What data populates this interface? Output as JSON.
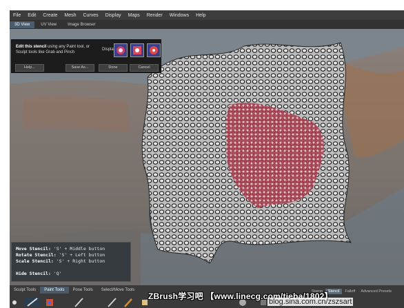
{
  "menu": [
    "File",
    "Edit",
    "Create",
    "Mesh",
    "Curves",
    "Display",
    "Maps",
    "Render",
    "Windows",
    "Help"
  ],
  "view_tabs": [
    "3D View",
    "UV View",
    "Image Browser"
  ],
  "stencil_panel": {
    "bold": "Edit this stencil",
    "text": " using any Paint tool, or Sculpt tools like Grab and Pinch",
    "display_label": "Display:",
    "buttons": [
      "Help...",
      "Save As...",
      "Done",
      "Cancel"
    ]
  },
  "hints": {
    "move_label": "Move Stencil:",
    "move_keys": "'S' + Middle button",
    "rotate_label": "Rotate Stencil:",
    "rotate_keys": "'S' + Left button",
    "scale_label": "Scale Stencil:",
    "scale_keys": "'S' + Right button",
    "hide_label": "Hide Stencil:",
    "hide_keys": "'Q'"
  },
  "bottom_tabs": [
    "Sculpt Tools",
    "Paint Tools",
    "Pose Tools",
    "Select/Move Tools"
  ],
  "right_tabs": [
    "Stamp",
    "Stencil",
    "Falloff",
    "Advanced Presets"
  ],
  "watermark": "ZBrush学习吧 【www.linecg.com/tieba/1802】",
  "blog": "blog.sina.com.cn/zszsart",
  "colors": {
    "accent": "#4a5d70",
    "stencil_red": "#b23a4a"
  }
}
